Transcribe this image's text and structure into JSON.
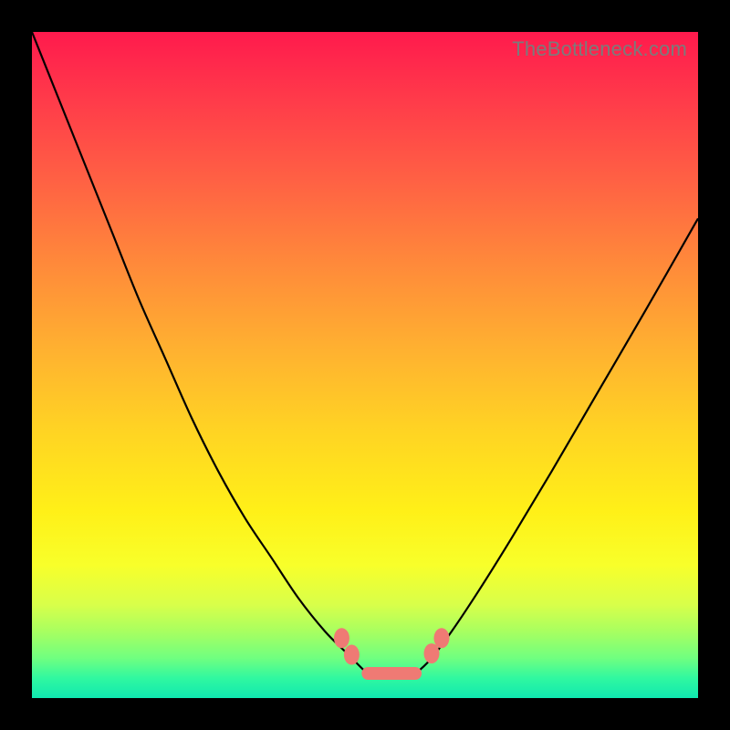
{
  "watermark": "TheBottleneck.com",
  "colors": {
    "background": "#000000",
    "curve": "#000000",
    "marker": "#ef7a74",
    "gradient_top": "#ff1a4d",
    "gradient_bottom": "#10e8b0"
  },
  "chart_data": {
    "type": "line",
    "title": "",
    "xlabel": "",
    "ylabel": "",
    "xlim": [
      0,
      100
    ],
    "ylim": [
      0,
      100
    ],
    "grid": false,
    "legend": false,
    "series": [
      {
        "name": "left-branch",
        "x": [
          0,
          4,
          8,
          12,
          16,
          20,
          24,
          28,
          32,
          36,
          40,
          44,
          47,
          49,
          50
        ],
        "y": [
          100,
          90,
          80,
          70,
          60,
          51,
          42,
          34,
          27,
          21,
          15,
          10,
          7,
          5,
          4
        ]
      },
      {
        "name": "right-branch",
        "x": [
          58,
          60,
          63,
          67,
          72,
          78,
          85,
          92,
          100
        ],
        "y": [
          4,
          6,
          10,
          16,
          24,
          34,
          46,
          58,
          72
        ]
      },
      {
        "name": "valley-floor",
        "x": [
          50,
          52,
          54,
          56,
          58
        ],
        "y": [
          4,
          3.5,
          3.4,
          3.5,
          4
        ]
      }
    ],
    "markers": [
      {
        "x": 46.5,
        "y": 9.0
      },
      {
        "x": 48.0,
        "y": 6.5
      },
      {
        "x": 60.0,
        "y": 6.7
      },
      {
        "x": 61.5,
        "y": 9.0
      }
    ],
    "valley_bar": {
      "x0": 49.5,
      "x1": 58.5,
      "y": 3.7
    }
  }
}
